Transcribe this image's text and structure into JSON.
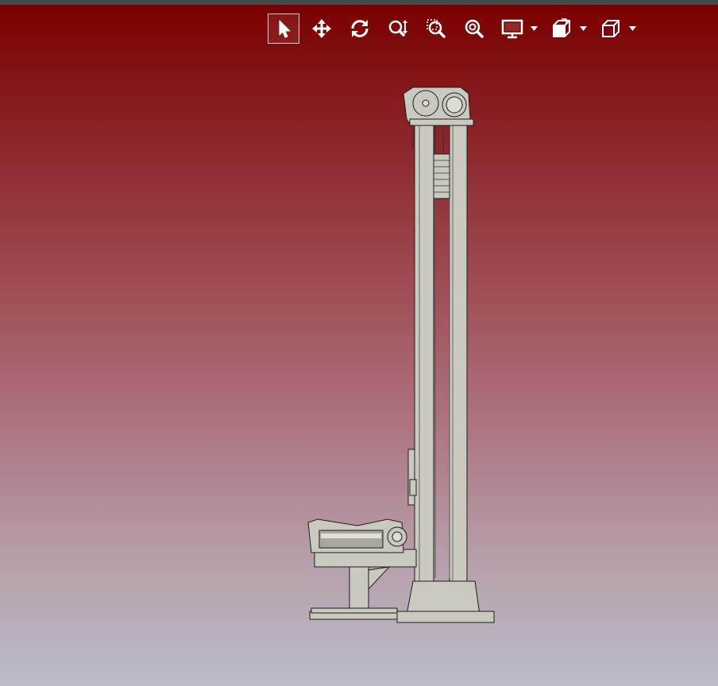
{
  "viewer": {
    "background_top": "#7a0000",
    "background_bottom": "#bcbcc8",
    "model_color": "#c9c9bf"
  },
  "toolbar": {
    "buttons": [
      {
        "icon": "select-arrow-icon",
        "active": true
      },
      {
        "icon": "pan-move-icon",
        "active": false
      },
      {
        "icon": "rotate-icon",
        "active": false
      },
      {
        "icon": "zoom-dynamic-icon",
        "active": false
      },
      {
        "icon": "zoom-window-icon",
        "active": false
      },
      {
        "icon": "zoom-fit-icon",
        "active": false
      },
      {
        "icon": "display-mode-icon",
        "active": false,
        "has_dropdown": true
      },
      {
        "icon": "view-orientation-icon",
        "active": false,
        "has_dropdown": true
      },
      {
        "icon": "standard-views-cube-icon",
        "active": false,
        "has_dropdown": true
      }
    ]
  }
}
